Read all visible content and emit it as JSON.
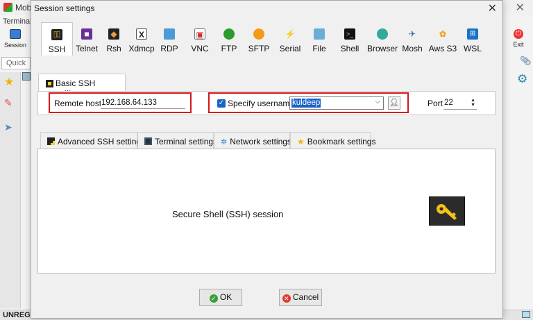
{
  "background_app": {
    "title": "Mob",
    "menu_terminal": "Terminal",
    "session_label": "Session",
    "quick_connect": "Quick c",
    "exit_label": "Exit",
    "status_text": "UNREG"
  },
  "dialog": {
    "title": "Session settings",
    "session_types": [
      {
        "label": "SSH",
        "icon": "ssh-key-icon",
        "active": true
      },
      {
        "label": "Telnet",
        "icon": "telnet-icon"
      },
      {
        "label": "Rsh",
        "icon": "rsh-icon"
      },
      {
        "label": "Xdmcp",
        "icon": "xdmcp-icon"
      },
      {
        "label": "RDP",
        "icon": "rdp-monitor-icon"
      },
      {
        "label": "VNC",
        "icon": "vnc-icon"
      },
      {
        "label": "FTP",
        "icon": "ftp-globe-icon"
      },
      {
        "label": "SFTP",
        "icon": "sftp-globe-icon"
      },
      {
        "label": "Serial",
        "icon": "serial-plug-icon"
      },
      {
        "label": "File",
        "icon": "file-monitor-icon"
      },
      {
        "label": "Shell",
        "icon": "shell-terminal-icon"
      },
      {
        "label": "Browser",
        "icon": "browser-globe-icon"
      },
      {
        "label": "Mosh",
        "icon": "mosh-satellite-icon"
      },
      {
        "label": "Aws S3",
        "icon": "aws-s3-icon"
      },
      {
        "label": "WSL",
        "icon": "wsl-windows-icon"
      }
    ],
    "basic_tab_label": "Basic SSH settings",
    "remote_host": {
      "label": "Remote host *",
      "value": "192.168.64.133"
    },
    "specify_username": {
      "label": "Specify username",
      "checked": true,
      "value": "kuldeep"
    },
    "port": {
      "label": "Port",
      "value": "22"
    },
    "advanced_tabs": [
      {
        "label": "Advanced SSH settings",
        "icon": "ssh-key-icon"
      },
      {
        "label": "Terminal settings",
        "icon": "terminal-icon"
      },
      {
        "label": "Network settings",
        "icon": "network-icon"
      },
      {
        "label": "Bookmark settings",
        "icon": "star-icon"
      }
    ],
    "session_description": "Secure Shell (SSH) session",
    "ok_label": "OK",
    "cancel_label": "Cancel",
    "highlight_color": "#d4171b",
    "accent_color": "#1a63c9"
  }
}
